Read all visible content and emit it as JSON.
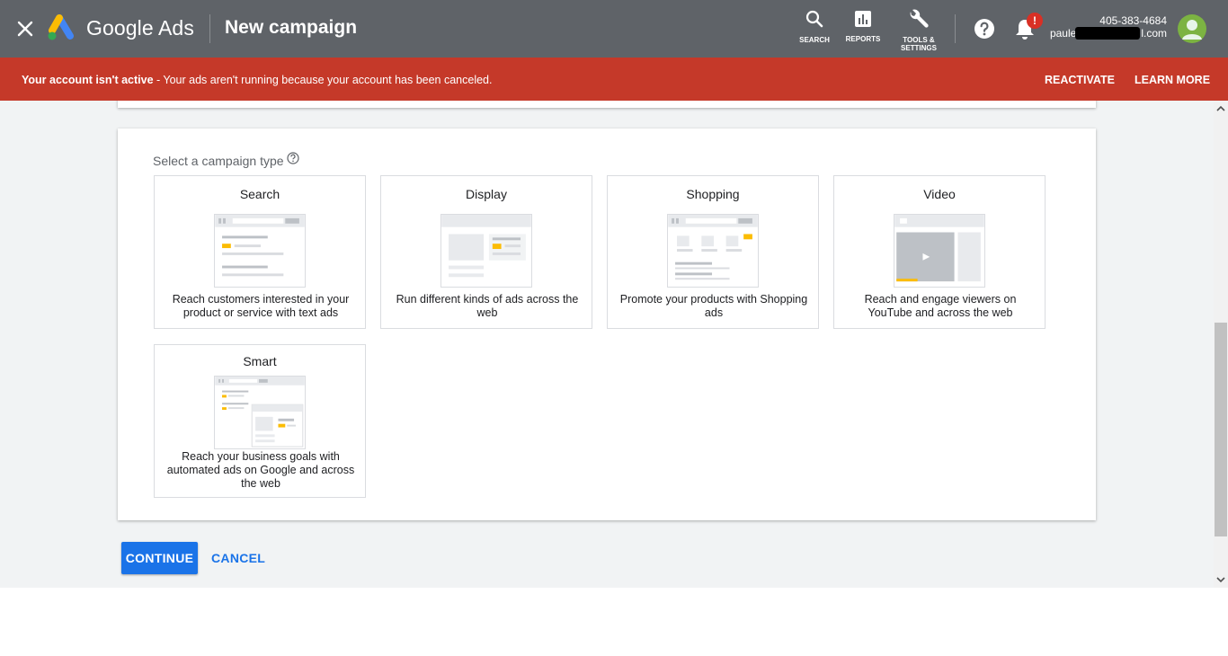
{
  "header": {
    "close_icon": "close-icon",
    "product_name": "Google Ads",
    "page_title": "New campaign",
    "tools": [
      {
        "label": "SEARCH",
        "icon": "search-icon"
      },
      {
        "label": "REPORTS",
        "icon": "bar-chart-icon"
      },
      {
        "label_line1": "TOOLS &",
        "label_line2": "SETTINGS",
        "icon": "wrench-icon"
      }
    ],
    "help_icon": "help-icon",
    "notifications": {
      "icon": "bell-icon",
      "badge": "!"
    },
    "account": {
      "id": "405-383-4684",
      "email_start": "paule",
      "email_end": "l.com"
    }
  },
  "alert": {
    "bold_text": "Your account isn't active",
    "text": " - Your ads aren't running because your account has been canceled.",
    "reactivate_label": "REACTIVATE",
    "learn_more_label": "LEARN MORE",
    "color": "#c53929"
  },
  "campaign_type": {
    "label": "Select a campaign type",
    "types": [
      {
        "title": "Search",
        "description": "Reach customers interested in your product or service with text ads"
      },
      {
        "title": "Display",
        "description": "Run different kinds of ads across the web"
      },
      {
        "title": "Shopping",
        "description": "Promote your products with Shopping ads"
      },
      {
        "title": "Video",
        "description": "Reach and engage viewers on YouTube and across the web"
      },
      {
        "title": "Smart",
        "description": "Reach your business goals with automated ads on Google and across the web"
      }
    ]
  },
  "actions": {
    "continue_label": "CONTINUE",
    "cancel_label": "CANCEL"
  },
  "colors": {
    "topbar": "#5f6368",
    "primary": "#1a73e8",
    "accent_yellow": "#fbbc04"
  }
}
